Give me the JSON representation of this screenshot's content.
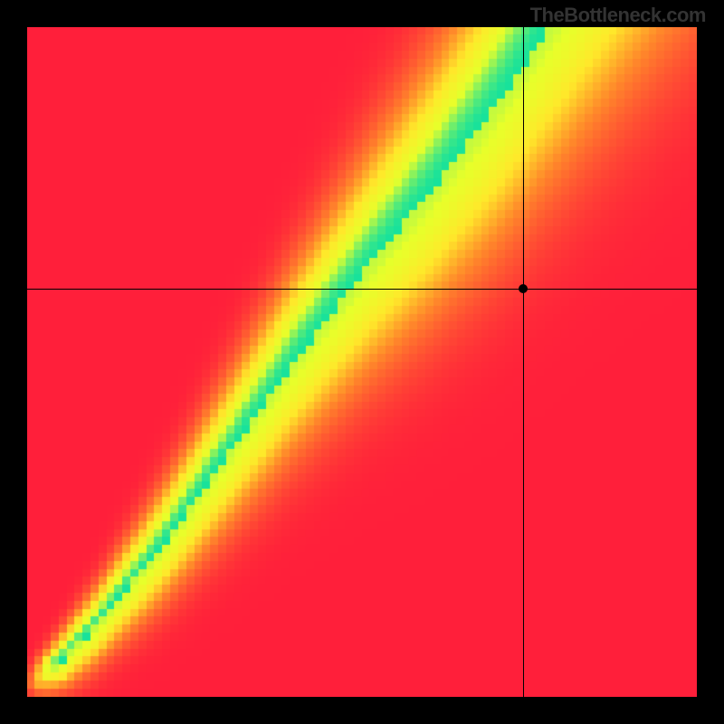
{
  "attribution": "TheBottleneck.com",
  "chart_data": {
    "type": "heatmap",
    "title": "",
    "xlabel": "",
    "ylabel": "",
    "xlim": [
      0,
      100
    ],
    "ylim": [
      0,
      100
    ],
    "grid": false,
    "legend": false,
    "color_scale": [
      {
        "stop": 0.0,
        "color": "#ff1f3a"
      },
      {
        "stop": 0.35,
        "color": "#ff8a2a"
      },
      {
        "stop": 0.6,
        "color": "#ffe82a"
      },
      {
        "stop": 0.82,
        "color": "#e7ff2a"
      },
      {
        "stop": 1.0,
        "color": "#18e29b"
      }
    ],
    "optimal_path": [
      {
        "x": 2,
        "y": 2
      },
      {
        "x": 10,
        "y": 10
      },
      {
        "x": 20,
        "y": 22
      },
      {
        "x": 30,
        "y": 36
      },
      {
        "x": 40,
        "y": 50
      },
      {
        "x": 50,
        "y": 63
      },
      {
        "x": 60,
        "y": 75
      },
      {
        "x": 70,
        "y": 88
      },
      {
        "x": 78,
        "y": 100
      }
    ],
    "crosshair": {
      "x": 74,
      "y": 61
    },
    "marker": {
      "x": 74,
      "y": 61
    },
    "pixelation": 84
  },
  "colors": {
    "background": "#000000",
    "crosshair": "#000000",
    "marker": "#000000"
  }
}
